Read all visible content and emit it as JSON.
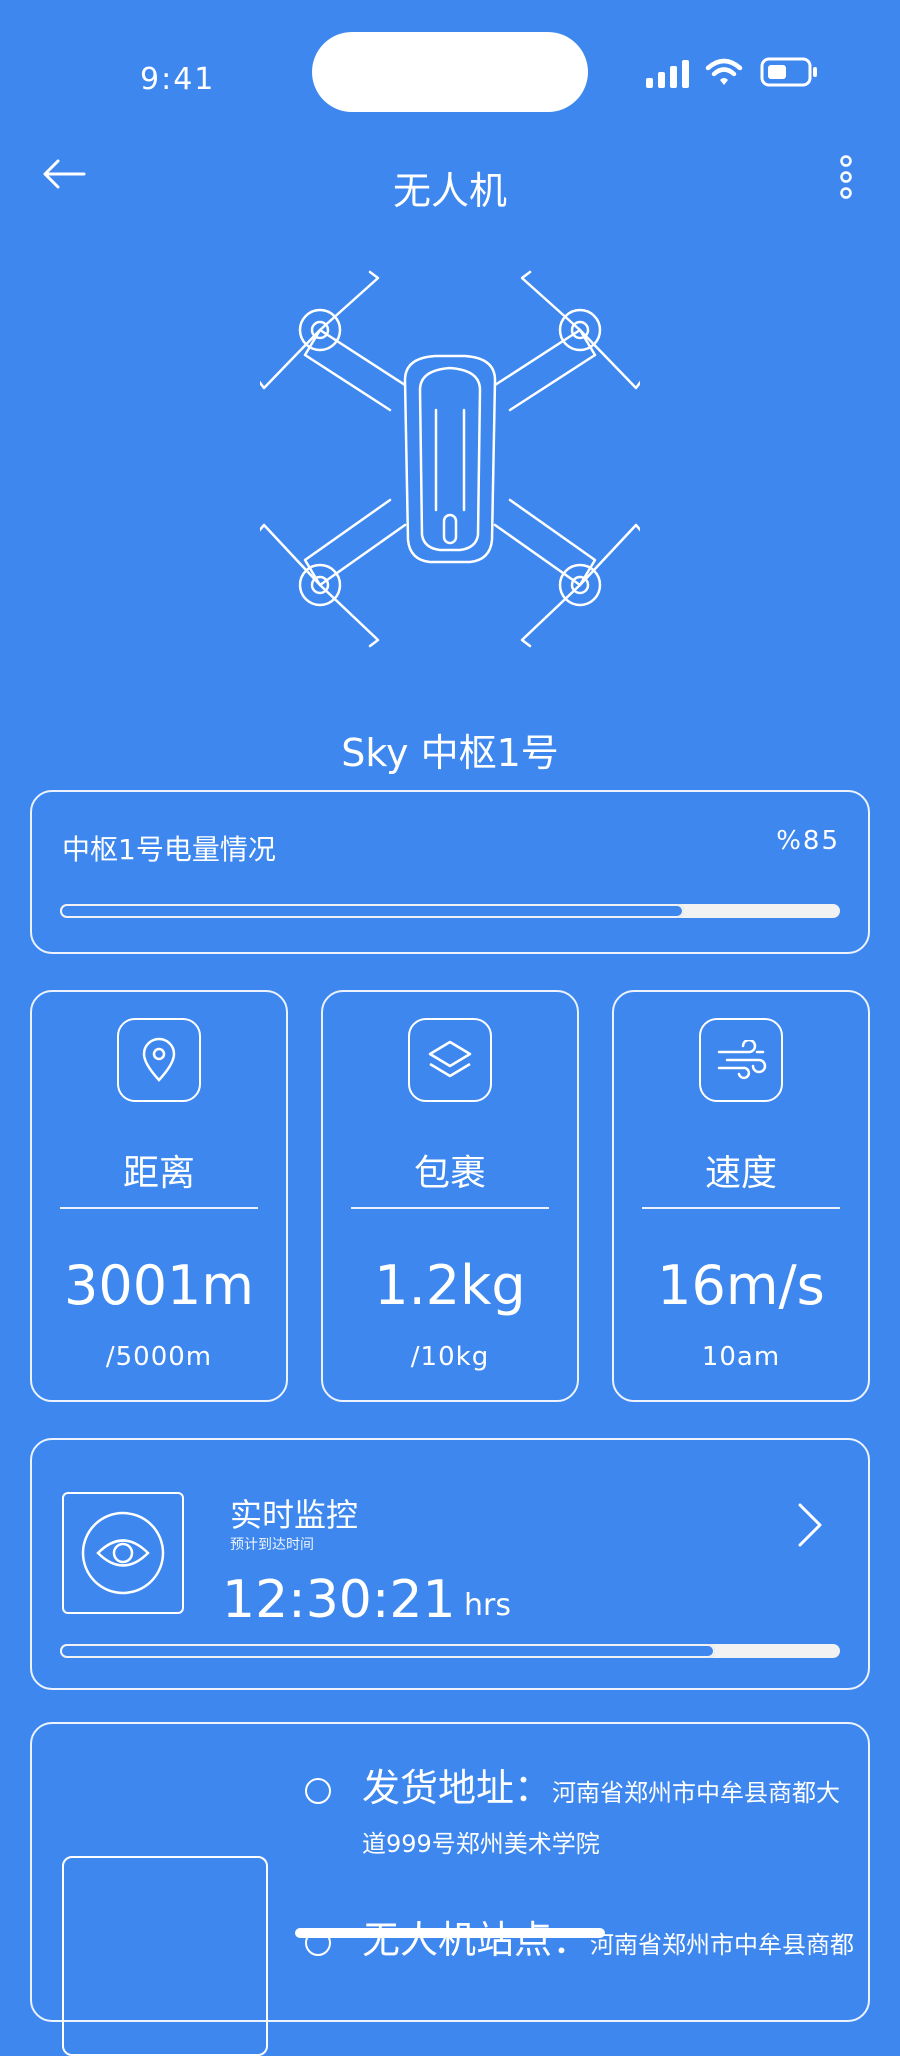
{
  "status_bar": {
    "time": "9:41"
  },
  "header": {
    "title": "无人机"
  },
  "drone": {
    "name": "Sky 中枢1号"
  },
  "battery": {
    "label": "中枢1号电量情况",
    "percent_text": "%85",
    "level": 0.8
  },
  "stats": [
    {
      "icon": "location-pin-icon",
      "label": "距离",
      "value": "3001m",
      "sub": "/5000m"
    },
    {
      "icon": "layers-icon",
      "label": "包裹",
      "value": "1.2kg",
      "sub": "/10kg"
    },
    {
      "icon": "wind-icon",
      "label": "速度",
      "value": "16m/s",
      "sub": "10am"
    }
  ],
  "monitor": {
    "title": "实时监控",
    "subtitle": "预计到达时间",
    "time": "12:30:21",
    "unit": "hrs",
    "progress": 0.84
  },
  "route": {
    "shipping_label": "发货地址：",
    "shipping_address_line1": "河南省郑州市中牟县商都大",
    "shipping_address_line2": "道999号郑州美术学院",
    "station_label": "无人机站点：",
    "station_address": "河南省郑州市中牟县商都"
  }
}
